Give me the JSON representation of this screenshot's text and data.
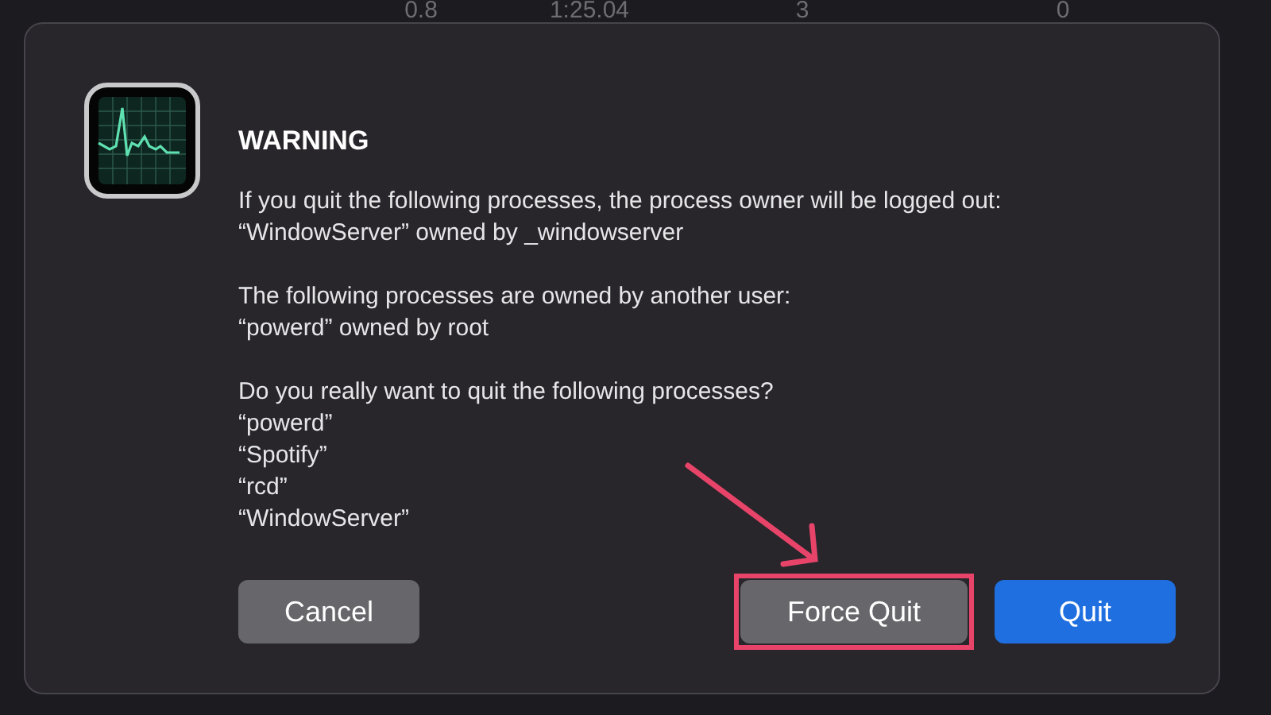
{
  "background_row": [
    "0.8",
    "1:25.04",
    "3",
    "0"
  ],
  "dialog": {
    "title": "WARNING",
    "sections": [
      {
        "lines": [
          "If you quit the following processes, the process owner will be logged out:",
          "“WindowServer” owned by _windowserver"
        ]
      },
      {
        "lines": [
          "The following processes are owned by another user:",
          "“powerd” owned by root"
        ]
      },
      {
        "lines": [
          "Do you really want to quit the following processes?",
          "“powerd”",
          "“Spotify”",
          "“rcd”",
          "“WindowServer”"
        ]
      }
    ],
    "buttons": [
      {
        "label": "Cancel",
        "kind": "secondary",
        "highlighted": false
      },
      {
        "label": "Force Quit",
        "kind": "secondary",
        "highlighted": true
      },
      {
        "label": "Quit",
        "kind": "primary",
        "highlighted": false
      }
    ]
  }
}
